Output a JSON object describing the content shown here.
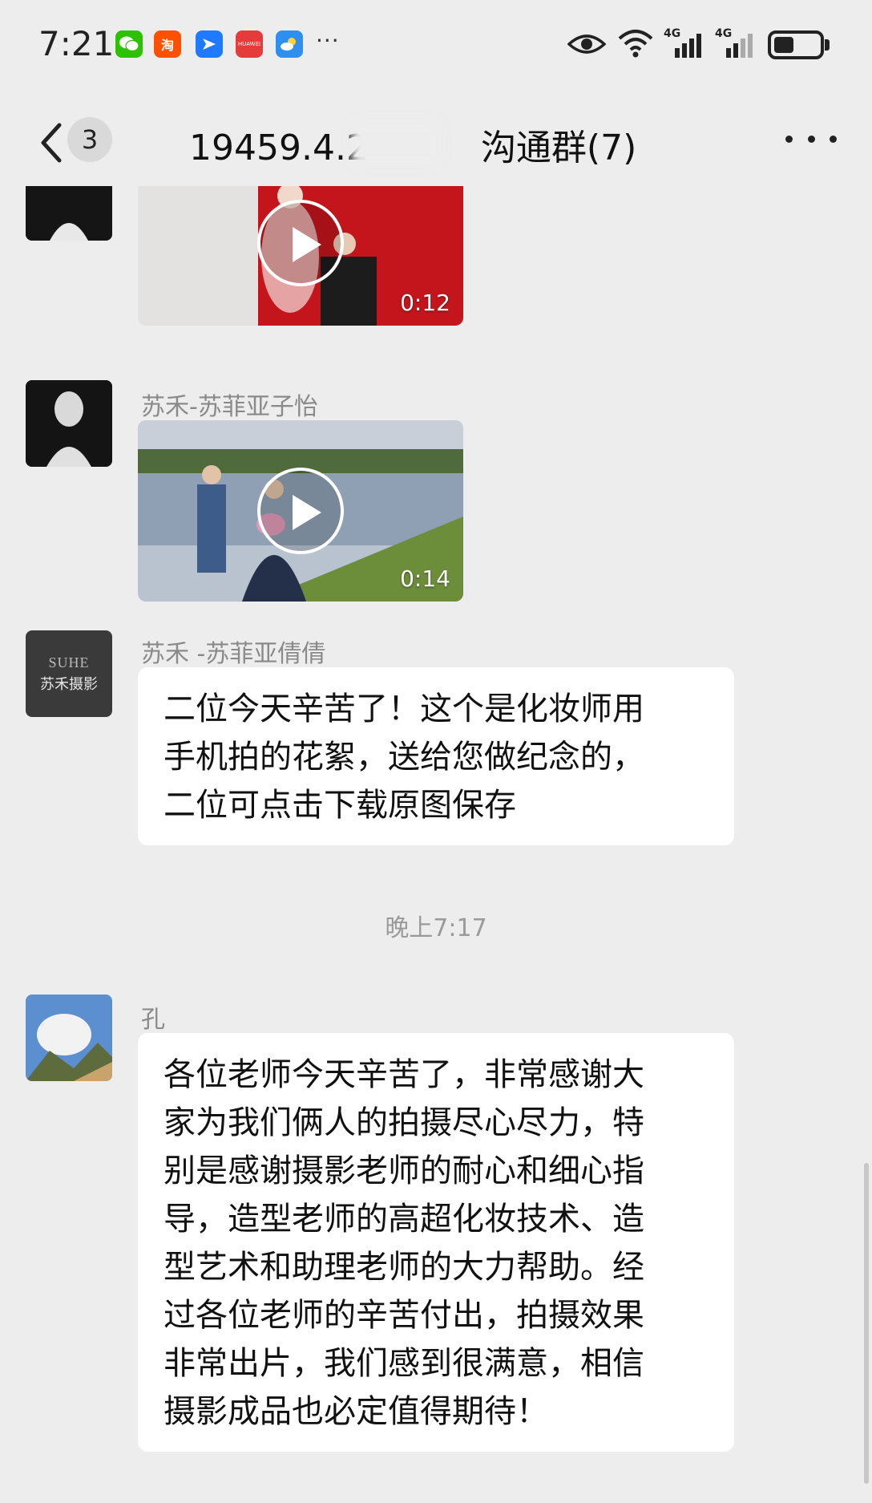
{
  "status_bar": {
    "time": "7:21",
    "app_icons": [
      "wechat-icon",
      "taobao-icon",
      "feishu-icon",
      "huawei-icon",
      "weather-icon"
    ],
    "more_indicator": "···",
    "huawei_label": "HUAWEI",
    "taobao_label": "淘",
    "signal_label_1": "4G",
    "signal_label_2": "4G",
    "battery_level": 0.45
  },
  "header": {
    "unread_count": "3",
    "title_prefix": "19459.4.2",
    "title_suffix": "沟通群(7)"
  },
  "messages": [
    {
      "type": "video",
      "duration": "0:12"
    },
    {
      "type": "video",
      "sender": "苏禾-苏菲亚子怡",
      "duration": "0:14"
    },
    {
      "type": "text",
      "sender": "苏禾 -苏菲亚倩倩",
      "avatar_line1": "SUHE",
      "avatar_line2": "苏禾摄影",
      "text": "二位今天辛苦了！这个是化妆师用\n手机拍的花絮，送给您做纪念的，\n二位可点击下载原图保存"
    },
    {
      "type": "time",
      "text": "晚上7:17"
    },
    {
      "type": "text",
      "sender": "孔",
      "text": "各位老师今天辛苦了，非常感谢大\n家为我们俩人的拍摄尽心尽力，特\n别是感谢摄影老师的耐心和细心指\n导，造型老师的高超化妆技术、造\n型艺术和助理老师的大力帮助。经\n过各位老师的辛苦付出，拍摄效果\n非常出片，我们感到很满意，相信\n摄影成品也必定值得期待！"
    }
  ]
}
